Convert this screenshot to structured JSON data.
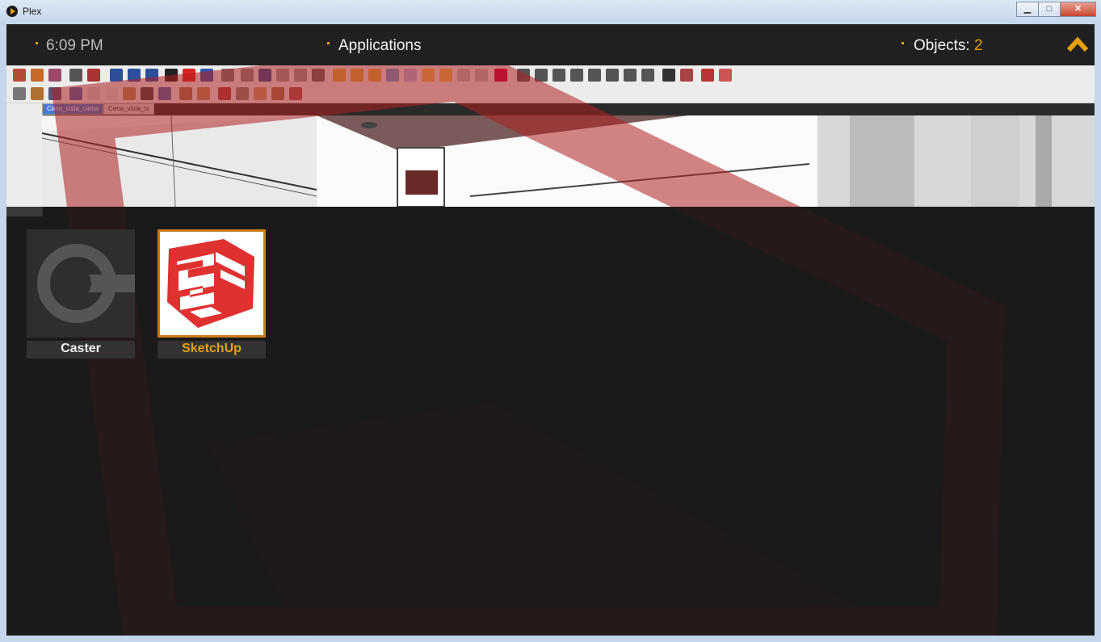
{
  "window": {
    "title": "Plex",
    "minimize_label": "▁",
    "maximize_label": "□",
    "close_label": "✕"
  },
  "header": {
    "clock": "6:09 PM",
    "section": "Applications",
    "objects_label": "Objects:",
    "objects_count": "2",
    "up_icon": "chevron-up-icon"
  },
  "colors": {
    "accent": "#e5a00d",
    "sketchup_red": "#e03131",
    "selection_border": "#cc7b19"
  },
  "background_app": {
    "scene_tabs": [
      "Cena_vista_cama",
      "Cena_vista_tv"
    ],
    "active_tab": "Cena_vista_cama"
  },
  "applications": [
    {
      "name": "Caster",
      "icon": "caster-icon",
      "selected": false
    },
    {
      "name": "SketchUp",
      "icon": "sketchup-icon",
      "selected": true
    }
  ]
}
